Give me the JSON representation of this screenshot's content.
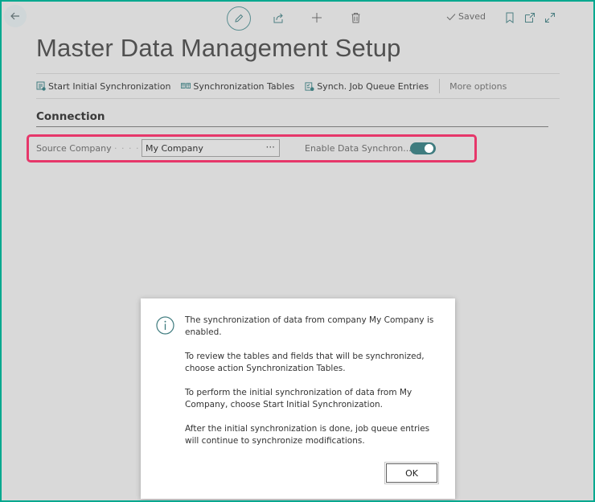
{
  "header": {
    "saved_label": "Saved",
    "icons": [
      "back-arrow-icon",
      "pencil-icon",
      "share-icon",
      "plus-icon",
      "trash-icon",
      "checkmark-icon",
      "bookmark-icon",
      "open-new-window-icon",
      "expand-icon"
    ]
  },
  "page": {
    "title": "Master Data Management Setup"
  },
  "actions": {
    "start_sync": "Start Initial Synchronization",
    "sync_tables": "Synchronization Tables",
    "job_queue": "Synch. Job Queue Entries",
    "more": "More options"
  },
  "connection": {
    "title": "Connection",
    "source_company_label": "Source Company",
    "source_company_value": "My Company",
    "source_company_dots": "· · · · · ·",
    "lookup": "···",
    "enable_label": "Enable Data Synchron...",
    "enable_on": true
  },
  "dialog": {
    "paragraphs": [
      "The synchronization of data from company My Company is enabled.",
      "To review the tables and fields that will be synchronized, choose action Synchronization Tables.",
      "To perform the initial synchronization of data from My Company, choose Start Initial Synchronization.",
      "After the initial synchronization is done, job queue entries will continue to synchronize modifications."
    ],
    "ok_label": "OK"
  },
  "colors": {
    "accent": "#3f7c7f",
    "highlight": "#e6376a",
    "frame": "#00a88f"
  }
}
